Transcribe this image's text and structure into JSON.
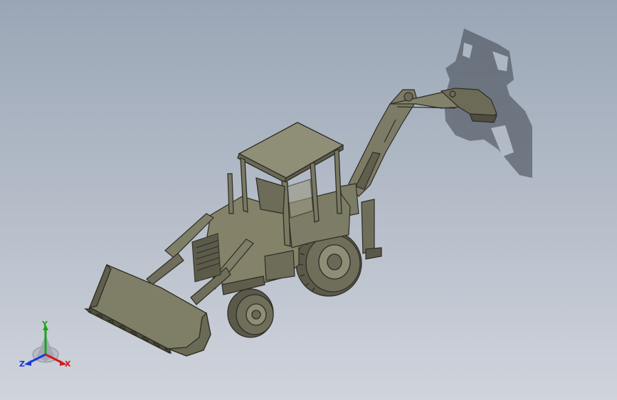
{
  "viewport": {
    "background_top": "#9aa6b6",
    "background_bottom": "#d0d4dc",
    "model_body_color": "#7c7b66",
    "model_edge_color": "#2e2d24",
    "shadow_color": "#3e444e"
  },
  "triad": {
    "icon": "xyz-axis-triad-icon",
    "x_label": "X",
    "y_label": "Y",
    "z_label": "Z",
    "x_color": "#d41a1a",
    "y_color": "#1aa61a",
    "z_color": "#1a3ad6"
  }
}
